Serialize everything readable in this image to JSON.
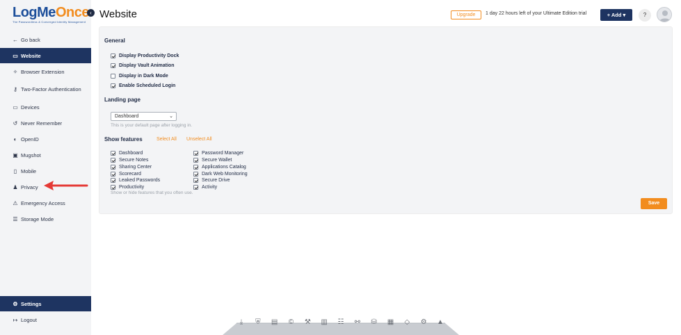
{
  "brand": {
    "logo_part1": "LogMe",
    "logo_part2": "Once",
    "logo_tagline": "The Passwordless & Converged Identity Management"
  },
  "sidebar": {
    "items": [
      {
        "label": "Go back",
        "icon": "arrow-left-icon"
      },
      {
        "label": "Website",
        "icon": "browser-window-icon",
        "active": true
      },
      {
        "label": "Browser Extension",
        "icon": "puzzle-icon"
      },
      {
        "label": "Two-Factor Authentication",
        "icon": "key-icon"
      },
      {
        "label": "Devices",
        "icon": "devices-icon"
      },
      {
        "label": "Never Remember",
        "icon": "undo-icon"
      },
      {
        "label": "OpenID",
        "icon": "openid-icon"
      },
      {
        "label": "Mugshot",
        "icon": "camera-icon"
      },
      {
        "label": "Mobile",
        "icon": "mobile-icon"
      },
      {
        "label": "Privacy",
        "icon": "incognito-icon"
      },
      {
        "label": "Emergency Access",
        "icon": "emergency-icon"
      },
      {
        "label": "Storage Mode",
        "icon": "database-icon"
      }
    ],
    "settings_label": "Settings",
    "logout_label": "Logout"
  },
  "header": {
    "title": "Website",
    "upgrade_label": "Upgrade",
    "trial_text": "1 day 22 hours left of your Ultimate Edition trial",
    "add_label": "+ Add ▾",
    "help_label": "?"
  },
  "general": {
    "title": "General",
    "options": [
      {
        "label": "Display Productivity Dock",
        "checked": true
      },
      {
        "label": "Display Vault Animation",
        "checked": true
      },
      {
        "label": "Display in Dark Mode",
        "checked": false
      },
      {
        "label": "Enable Scheduled Login",
        "checked": true
      }
    ]
  },
  "landing": {
    "title": "Landing page",
    "selected": "Dashboard",
    "hint": "This is your default page after logging in."
  },
  "features": {
    "title": "Show features",
    "select_all": "Select All",
    "unselect_all": "Unselect All",
    "col1": [
      {
        "label": "Dashboard",
        "checked": true
      },
      {
        "label": "Secure Notes",
        "checked": true
      },
      {
        "label": "Sharing Center",
        "checked": true
      },
      {
        "label": "Scorecard",
        "checked": true
      },
      {
        "label": "Leaked Passwords",
        "checked": true
      },
      {
        "label": "Productivity",
        "checked": true
      }
    ],
    "col2": [
      {
        "label": "Password Manager",
        "checked": true
      },
      {
        "label": "Secure Wallet",
        "checked": true
      },
      {
        "label": "Applications Catalog",
        "checked": true
      },
      {
        "label": "Dark Web Monitoring",
        "checked": true
      },
      {
        "label": "Secure Drive",
        "checked": true
      },
      {
        "label": "Activity",
        "checked": true
      }
    ],
    "hint": "Show or hide features that you often use."
  },
  "save_label": "Save",
  "dock_icons": [
    "download-icon",
    "shield-icon",
    "wallet-icon",
    "copyright-icon",
    "tools-icon",
    "chart-icon",
    "notes-icon",
    "share-icon",
    "drive-icon",
    "catalog-icon",
    "tag-icon",
    "gear-icon",
    "graduation-icon"
  ],
  "colors": {
    "navy": "#1e3461",
    "orange": "#f28c1e",
    "arrow_red": "#e53935"
  }
}
